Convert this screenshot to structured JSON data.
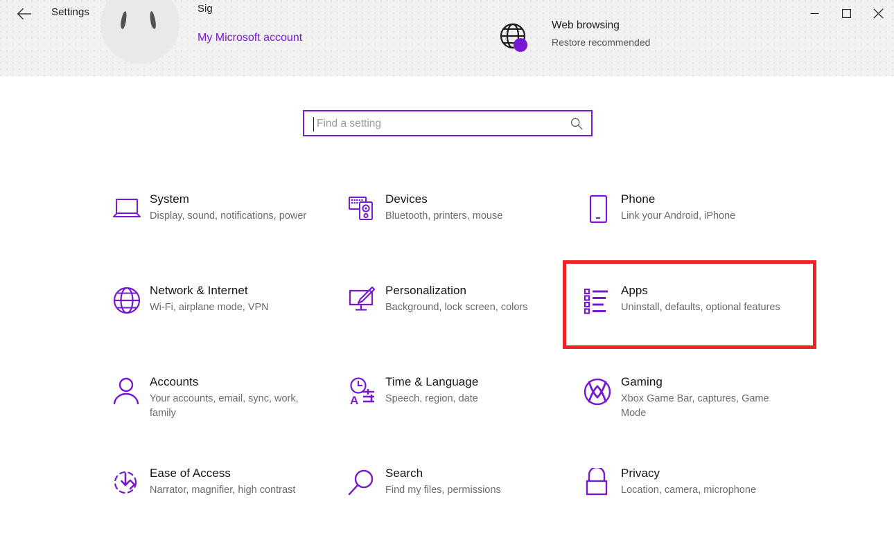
{
  "window": {
    "title": "Settings",
    "back_icon": "arrow-left-icon",
    "minimize_label": "–",
    "maximize_label": "□",
    "close_label": "✕"
  },
  "header": {
    "account_name": "Sig",
    "account_link": "My Microsoft account",
    "avatar_icon": "user-avatar",
    "status": {
      "icon": "globe-icon",
      "title": "Web browsing",
      "description": "Restore recommended"
    }
  },
  "search": {
    "placeholder": "Find a setting",
    "value": "",
    "icon": "search-icon"
  },
  "colors": {
    "accent": "#7719d1",
    "highlight": "#ee2222",
    "header_background": "#f2f2f2",
    "title_text": "#161616",
    "description_text": "#6a6a6a"
  },
  "highlighted_tile": "apps",
  "tiles": [
    {
      "id": "system",
      "icon": "laptop-icon",
      "title": "System",
      "description": "Display, sound, notifications, power"
    },
    {
      "id": "devices",
      "icon": "devices-icon",
      "title": "Devices",
      "description": "Bluetooth, printers, mouse"
    },
    {
      "id": "phone",
      "icon": "phone-icon",
      "title": "Phone",
      "description": "Link your Android, iPhone"
    },
    {
      "id": "network-internet",
      "icon": "globe-icon",
      "title": "Network & Internet",
      "description": "Wi-Fi, airplane mode, VPN"
    },
    {
      "id": "personalization",
      "icon": "paintbrush-monitor-icon",
      "title": "Personalization",
      "description": "Background, lock screen, colors"
    },
    {
      "id": "apps",
      "icon": "bulleted-list-icon",
      "title": "Apps",
      "description": "Uninstall, defaults, optional features"
    },
    {
      "id": "accounts",
      "icon": "person-icon",
      "title": "Accounts",
      "description": "Your accounts, email, sync, work, family"
    },
    {
      "id": "time-language",
      "icon": "clock-language-icon",
      "title": "Time & Language",
      "description": "Speech, region, date"
    },
    {
      "id": "gaming",
      "icon": "xbox-icon",
      "title": "Gaming",
      "description": "Xbox Game Bar, captures, Game Mode"
    },
    {
      "id": "ease-of-access",
      "icon": "accessibility-icon",
      "title": "Ease of Access",
      "description": "Narrator, magnifier, high contrast"
    },
    {
      "id": "search",
      "icon": "magnifier-icon",
      "title": "Search",
      "description": "Find my files, permissions"
    },
    {
      "id": "privacy",
      "icon": "lock-icon",
      "title": "Privacy",
      "description": "Location, camera, microphone"
    }
  ]
}
